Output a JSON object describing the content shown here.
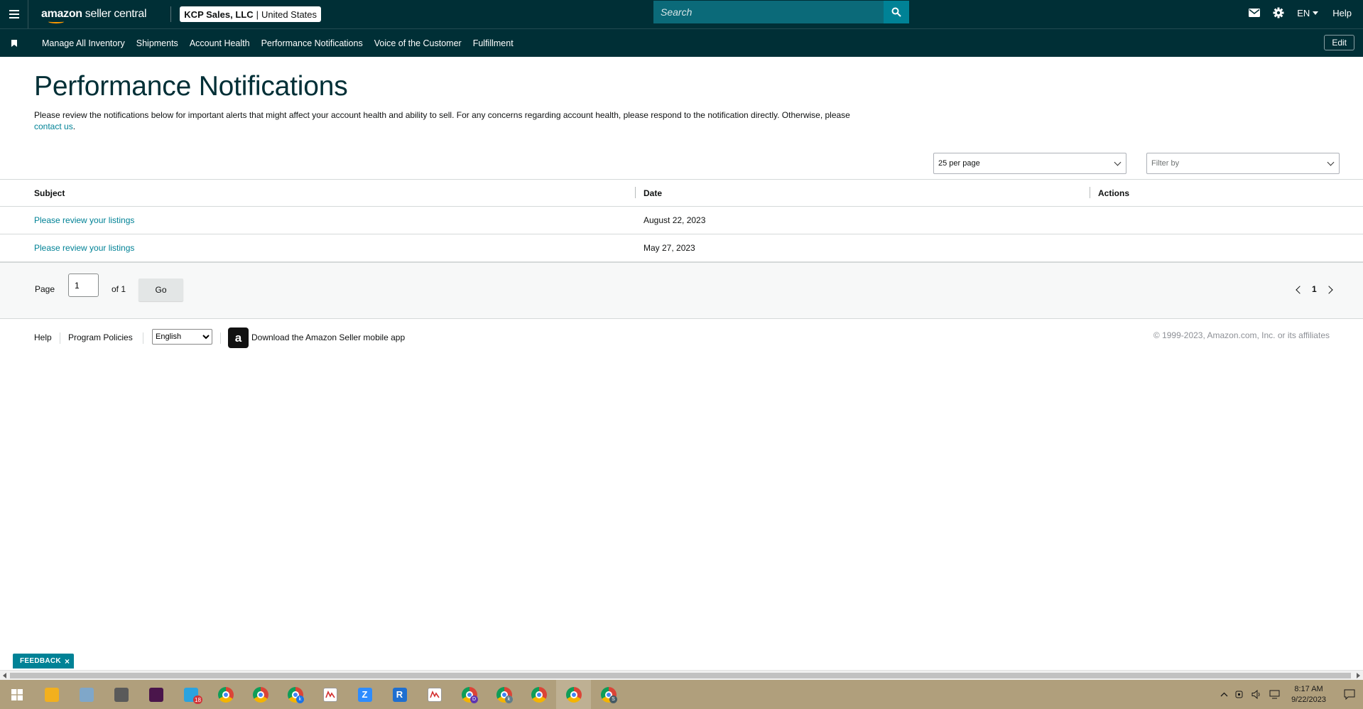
{
  "header": {
    "brand_bold": "amazon",
    "brand_rest": "seller central",
    "account_name": "KCP Sales, LLC",
    "account_sep": "|",
    "account_region": "United States",
    "search_placeholder": "Search",
    "language": "EN",
    "help_label": "Help"
  },
  "nav": {
    "items": [
      {
        "label": "Manage All Inventory"
      },
      {
        "label": "Shipments"
      },
      {
        "label": "Account Health"
      },
      {
        "label": "Performance Notifications"
      },
      {
        "label": "Voice of the Customer"
      },
      {
        "label": "Fulfillment"
      }
    ],
    "edit_label": "Edit"
  },
  "main": {
    "title": "Performance Notifications",
    "intro_text": "Please review the notifications below for important alerts that might affect your account health and ability to sell. For any concerns regarding account health, please respond to the notification directly. Otherwise, please",
    "intro_link": "contact us",
    "intro_end": ".",
    "per_page_value": "25 per page",
    "filter_placeholder": "Filter by"
  },
  "table": {
    "headers": {
      "subject": "Subject",
      "date": "Date",
      "actions": "Actions"
    },
    "rows": [
      {
        "subject": "Please review your listings",
        "date": "August 22, 2023"
      },
      {
        "subject": "Please review your listings",
        "date": "May 27, 2023"
      }
    ]
  },
  "pager": {
    "page_label": "Page",
    "page_value": "1",
    "of_label": "of 1",
    "go_label": "Go",
    "current_page": "1"
  },
  "footer": {
    "help": "Help",
    "program_policies": "Program Policies",
    "language_option": "English",
    "app_icon_letter": "a",
    "app_text": "Download the Amazon Seller mobile app",
    "copyright": "© 1999-2023, Amazon.com, Inc. or its affiliates"
  },
  "feedback": {
    "label": "FEEDBACK",
    "close": "×"
  },
  "taskbar": {
    "apps": [
      {
        "name": "file-explorer-icon",
        "color": "#f2b01e"
      },
      {
        "name": "paint-app-icon",
        "color": "#7fa7c9"
      },
      {
        "name": "calculator-icon",
        "color": "#5a5a5a"
      },
      {
        "name": "slack-icon",
        "color": "#4a154b"
      },
      {
        "name": "telegram-icon",
        "color": "#2aa3df",
        "badge": "18"
      },
      {
        "name": "chrome-icon"
      },
      {
        "name": "chrome-profile-icon"
      },
      {
        "name": "chrome-profile-k-icon",
        "mini": "k",
        "mini_color": "#1a73e8"
      },
      {
        "name": "sheets-chart-icon",
        "color": "#ffffff"
      },
      {
        "name": "zoom-icon",
        "color": "#2d8cff",
        "letter": "Z"
      },
      {
        "name": "r-app-icon",
        "color": "#1f6fd0",
        "letter": "R"
      },
      {
        "name": "sheets-chart-2-icon",
        "color": "#ffffff"
      },
      {
        "name": "chrome-profile-d-icon",
        "mini": "D",
        "mini_color": "#5e35b1"
      },
      {
        "name": "chrome-profile-k2-icon",
        "mini": "k",
        "mini_color": "#607d8b"
      },
      {
        "name": "chrome-alt-icon"
      },
      {
        "name": "chrome-active-icon",
        "active": true
      },
      {
        "name": "chrome-profile-s-icon",
        "mini": "S",
        "mini_color": "#455a64"
      }
    ],
    "time": "8:17 AM",
    "date": "9/22/2023"
  }
}
